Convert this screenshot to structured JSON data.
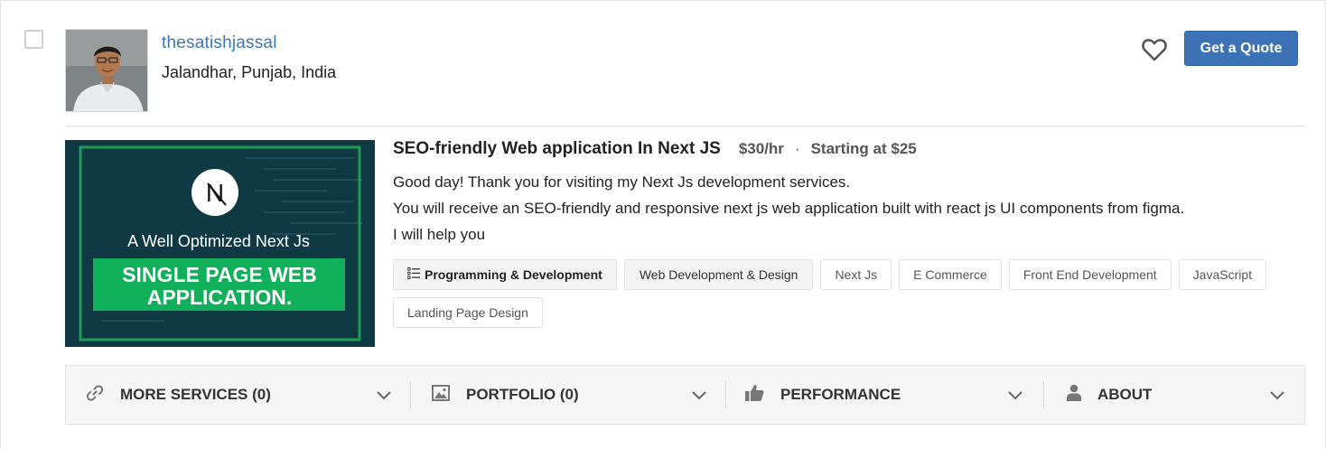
{
  "seller": {
    "username": "thesatishjassal",
    "location": "Jalandhar, Punjab, India"
  },
  "actions": {
    "quote_label": "Get a Quote",
    "favorite_icon": "heart-outline-icon"
  },
  "service": {
    "title": "SEO-friendly Web application In Next JS",
    "rate": "$30/hr",
    "separator": "·",
    "starting": "Starting at $25",
    "description": [
      "Good day! Thank you for visiting my Next Js development services.",
      "You will receive an SEO-friendly and responsive next js web application built with react js UI components from figma.",
      "I will help you"
    ],
    "thumbnail": {
      "logo_letter": "N",
      "tagline": "A Well Optimized Next Js",
      "banner_line1": "SINGLE PAGE WEB",
      "banner_line2": "APPLICATION.",
      "colors": {
        "background": "#0f3a44",
        "frame": "#1f9a55",
        "banner": "#10b05a"
      }
    }
  },
  "tags": [
    {
      "label": "Programming & Development",
      "style": "primary",
      "icon": "list-icon"
    },
    {
      "label": "Web Development & Design",
      "style": "secondary"
    },
    {
      "label": "Next Js",
      "style": "plain"
    },
    {
      "label": "E Commerce",
      "style": "plain"
    },
    {
      "label": "Front End Development",
      "style": "plain"
    },
    {
      "label": "JavaScript",
      "style": "plain"
    },
    {
      "label": "Landing Page Design",
      "style": "plain"
    }
  ],
  "sections": {
    "more_services": "MORE SERVICES (0)",
    "portfolio": "PORTFOLIO (0)",
    "performance": "PERFORMANCE",
    "about": "ABOUT"
  },
  "colors": {
    "link": "#3a77b6",
    "button": "#3d73b5"
  }
}
